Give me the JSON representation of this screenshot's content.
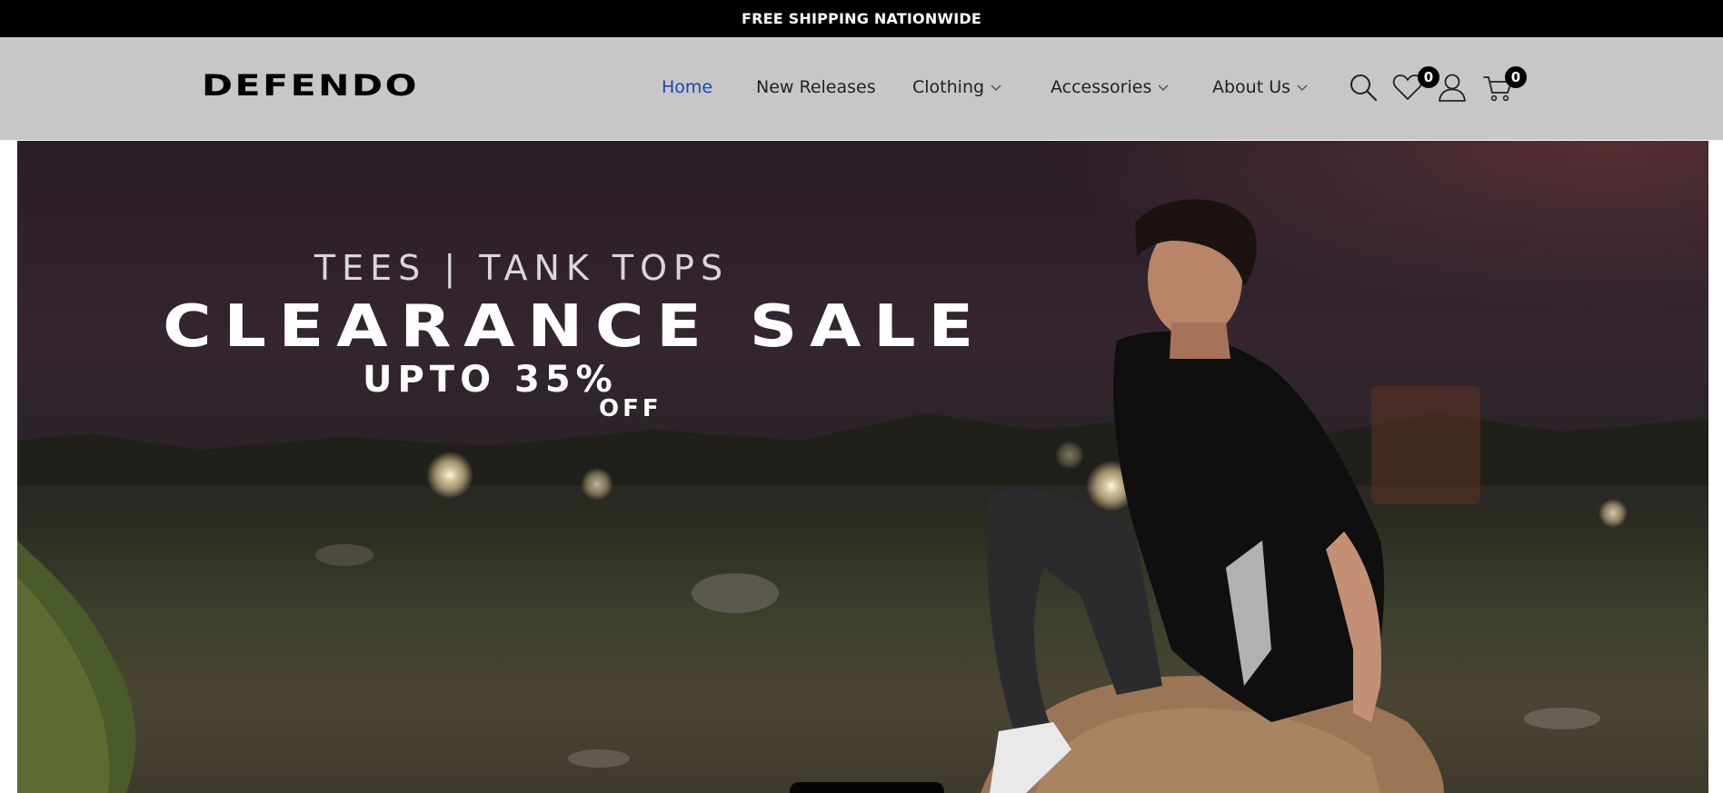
{
  "announcement": {
    "text": "FREE SHIPPING NATIONWIDE"
  },
  "brand": {
    "name": "DEFENDO"
  },
  "nav": {
    "items": [
      {
        "label": "Home",
        "active": true
      },
      {
        "label": "New Releases"
      },
      {
        "label": "Clothing",
        "has_dropdown": true
      },
      {
        "label": "Accessories",
        "has_dropdown": true
      },
      {
        "label": "About Us",
        "has_dropdown": true
      }
    ]
  },
  "header_icons": {
    "search": "search-icon",
    "wishlist": "heart-icon",
    "account": "user-icon",
    "cart": "cart-icon",
    "wishlist_count": "0",
    "cart_count": "0"
  },
  "hero": {
    "subtitle": "TEES | TANK TOPS",
    "title": "CLEARANCE SALE",
    "offer_line": "UPTO 35%",
    "offer_suffix": "OFF"
  },
  "colors": {
    "announcement_bg": "#000000",
    "header_bg": "#c7c7c7",
    "active_link": "#1a44b8",
    "badge_bg": "#000000"
  }
}
